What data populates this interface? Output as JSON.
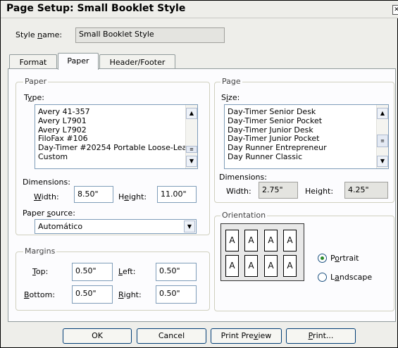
{
  "window": {
    "title": "Page Setup: Small Booklet Style"
  },
  "style_name": {
    "label_pre": "Style ",
    "label_u": "n",
    "label_post": "ame:",
    "value": "Small Booklet Style"
  },
  "tabs": [
    {
      "label": "Format"
    },
    {
      "label": "Paper"
    },
    {
      "label": "Header/Footer"
    }
  ],
  "paper": {
    "legend": "Paper",
    "type_label_pre": "T",
    "type_label_u": "y",
    "type_label_post": "pe:",
    "types": [
      "Avery 41-357",
      "Avery L7901",
      "Avery L7902",
      "FiloFax #106",
      "Day-Timer #20254 Portable Loose-Lea",
      "Custom"
    ],
    "dimensions_label": "Dimensions:",
    "width_label_u": "W",
    "width_label_post": "idth:",
    "width_value": "8.50\"",
    "height_label_pre": "H",
    "height_label_u": "e",
    "height_label_post": "ight:",
    "height_value": "11.00\"",
    "source_label_pre": "Paper ",
    "source_label_u": "s",
    "source_label_post": "ource:",
    "source_value": "Automático"
  },
  "margins": {
    "legend": "Margins",
    "top_u": "T",
    "top_post": "op:",
    "top_value": "0.50\"",
    "left_u": "L",
    "left_post": "eft:",
    "left_value": "0.50\"",
    "bottom_u": "B",
    "bottom_post": "ottom:",
    "bottom_value": "0.50\"",
    "right_u": "R",
    "right_post": "ight:",
    "right_value": "0.50\""
  },
  "page": {
    "legend": "Page",
    "size_label_pre": "S",
    "size_label_u": "i",
    "size_label_post": "ze:",
    "sizes": [
      "Day-Timer Senior Desk",
      "Day-Timer Senior Pocket",
      "Day-Timer Junior Desk",
      "Day-Timer Junior Pocket",
      "Day Runner Entrepreneur",
      "Day Runner Classic"
    ],
    "dimensions_label": "Dimensions:",
    "width_label": "Width:",
    "width_value": "2.75\"",
    "height_label": "Height:",
    "height_value": "4.25\""
  },
  "orientation": {
    "legend": "Orientation",
    "portrait_pre": "P",
    "portrait_u": "o",
    "portrait_post": "rtrait",
    "landscape_pre": "L",
    "landscape_u": "a",
    "landscape_post": "ndscape",
    "selected": "portrait",
    "page_letters": [
      "A",
      "A",
      "A",
      "A",
      "A",
      "A",
      "A",
      "A"
    ]
  },
  "buttons": {
    "ok": "OK",
    "cancel": "Cancel",
    "preview_pre": "Print Pre",
    "preview_u": "v",
    "preview_post": "iew",
    "print_u": "P",
    "print_post": "rint..."
  },
  "icons": {
    "close": "close-icon",
    "scroll_up": "chevron-up-icon",
    "scroll_down": "chevron-down-icon",
    "dropdown": "chevron-down-icon"
  }
}
